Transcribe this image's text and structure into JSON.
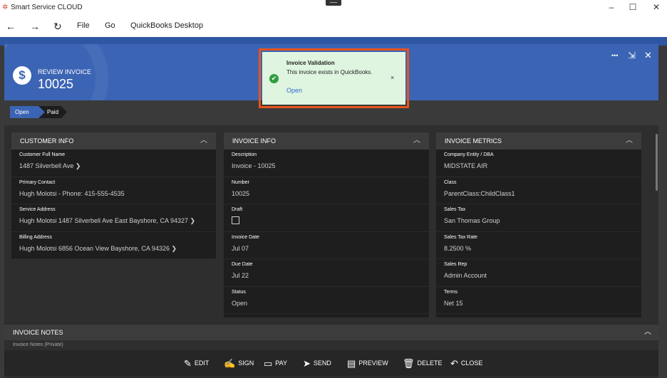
{
  "window": {
    "app_title": "Smart Service CLOUD",
    "app_icon": "smart-service-logo-icon",
    "minimize": "–",
    "maximize": "☐",
    "close": "✕"
  },
  "nav": {
    "back": "←",
    "forward": "→",
    "refresh": "↻",
    "menu": [
      "File",
      "Go",
      "QuickBooks Desktop"
    ]
  },
  "header": {
    "icon": "dollar-icon",
    "label": "REVIEW INVOICE",
    "number": "10025",
    "more": "•••",
    "collapse": "⇲",
    "close": "✕"
  },
  "status_steps": [
    "Open",
    "Paid"
  ],
  "customer_info": {
    "title": "CUSTOMER INFO",
    "fields": [
      {
        "label": "Customer Full Name",
        "value": "1487 Silverbell Ave  ❯"
      },
      {
        "label": "Primary Contact",
        "value": "Hugh Molotsi - Phone: 415-555-4535"
      },
      {
        "label": "Service Address",
        "value": "Hugh Molotsi 1487 Silverbell Ave East Bayshore, CA 94327  ❯"
      },
      {
        "label": "Billing Address",
        "value": "Hugh Molotsi 6856 Ocean View Bayshore, CA 94326  ❯"
      }
    ]
  },
  "invoice_info": {
    "title": "INVOICE INFO",
    "fields": [
      {
        "label": "Description",
        "value": "Invoice - 10025"
      },
      {
        "label": "Number",
        "value": "10025"
      },
      {
        "label": "Draft",
        "value": ""
      },
      {
        "label": "Invoice Date",
        "value": "Jul 07"
      },
      {
        "label": "Due Date",
        "value": "Jul 22"
      },
      {
        "label": "Status",
        "value": "Open"
      }
    ]
  },
  "invoice_metrics": {
    "title": "INVOICE METRICS",
    "fields": [
      {
        "label": "Company Entity / DBA",
        "value": "MIDSTATE AIR"
      },
      {
        "label": "Class",
        "value": "ParentClass:ChildClass1"
      },
      {
        "label": "Sales Tax",
        "value": "San Thomas Group"
      },
      {
        "label": "Sales Tax Rate",
        "value": "8.2500 %"
      },
      {
        "label": "Sales Rep",
        "value": "Admin Account"
      },
      {
        "label": "Terms",
        "value": "Net 15"
      }
    ]
  },
  "notes": {
    "title": "INVOICE NOTES",
    "sub": "Invoice Notes (Private)"
  },
  "actions": [
    {
      "icon": "pencil-icon",
      "glyph": "✎",
      "label": "EDIT"
    },
    {
      "icon": "sign-icon",
      "glyph": "✍",
      "label": "SIGN"
    },
    {
      "icon": "credit-card-icon",
      "glyph": "▭",
      "label": "PAY"
    },
    {
      "icon": "send-icon",
      "glyph": "➤",
      "label": "SEND"
    },
    {
      "icon": "preview-icon",
      "glyph": "▤",
      "label": "PREVIEW"
    },
    {
      "icon": "trash-icon",
      "glyph": "🗑",
      "label": "DELETE"
    },
    {
      "icon": "undo-icon",
      "glyph": "↶",
      "label": "CLOSE"
    }
  ],
  "toast": {
    "title": "Invoice Validation",
    "message": "This invoice exists in QuickBooks.",
    "link": "Open",
    "close": "×",
    "accent_color": "#e8541c",
    "bg_color": "#dff5df"
  },
  "colors": {
    "header_blue": "#3b64b4",
    "panel_dark": "#1e1e1e"
  }
}
